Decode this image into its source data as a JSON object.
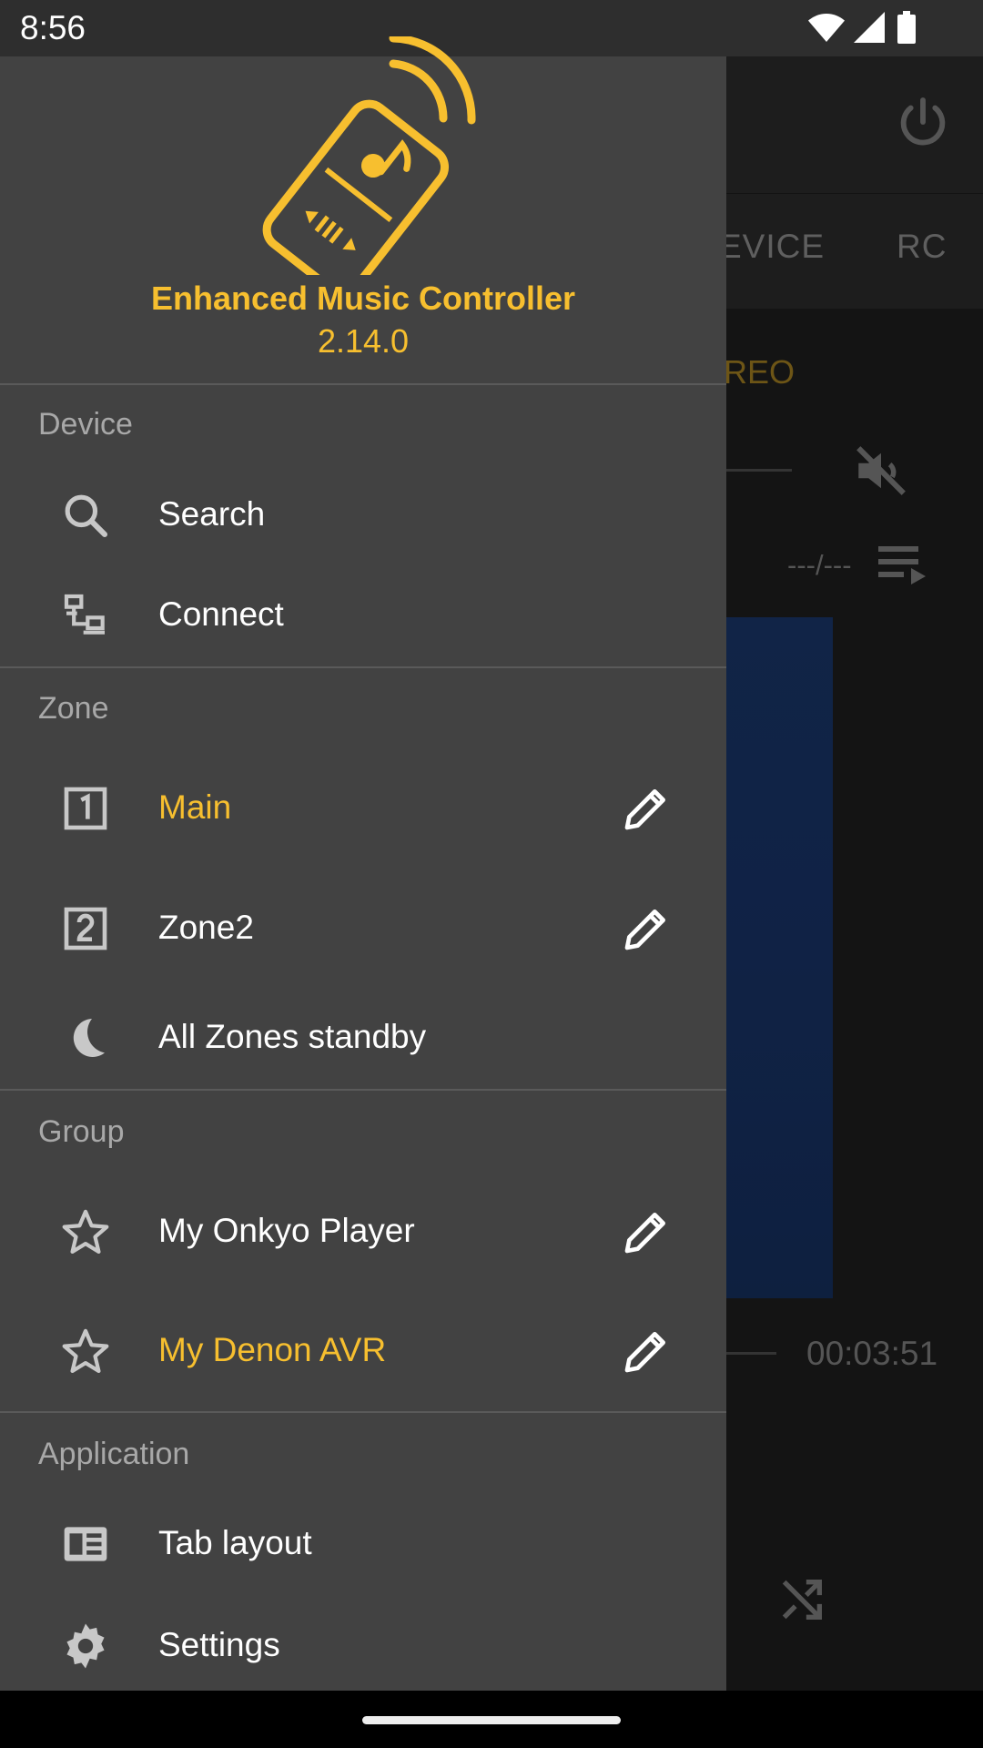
{
  "status_bar": {
    "time": "8:56"
  },
  "background": {
    "tabs": [
      "EVICE",
      "RC"
    ],
    "listening_mode": "REO",
    "track_counter": "---/---",
    "elapsed_time": "00:03:51"
  },
  "drawer": {
    "app_name": "Enhanced Music Controller",
    "version": "2.14.0",
    "sections": {
      "device": {
        "title": "Device",
        "items": [
          {
            "label": "Search",
            "icon": "search-icon"
          },
          {
            "label": "Connect",
            "icon": "connect-icon"
          }
        ]
      },
      "zone": {
        "title": "Zone",
        "items": [
          {
            "label": "Main",
            "icon": "zone-1-icon",
            "active": true
          },
          {
            "label": "Zone2",
            "icon": "zone-2-icon"
          },
          {
            "label": "All Zones standby",
            "icon": "moon-icon"
          }
        ]
      },
      "group": {
        "title": "Group",
        "items": [
          {
            "label": "My Onkyo Player",
            "icon": "star-icon"
          },
          {
            "label": "My Denon AVR",
            "icon": "star-icon",
            "active": true
          }
        ]
      },
      "application": {
        "title": "Application",
        "items": [
          {
            "label": "Tab layout",
            "icon": "tab-layout-icon"
          },
          {
            "label": "Settings",
            "icon": "gear-icon"
          }
        ]
      }
    }
  },
  "colors": {
    "accent": "#f7bf2f",
    "drawer_bg": "#424242",
    "text": "#ffffff",
    "section": "#a8a8a8"
  }
}
